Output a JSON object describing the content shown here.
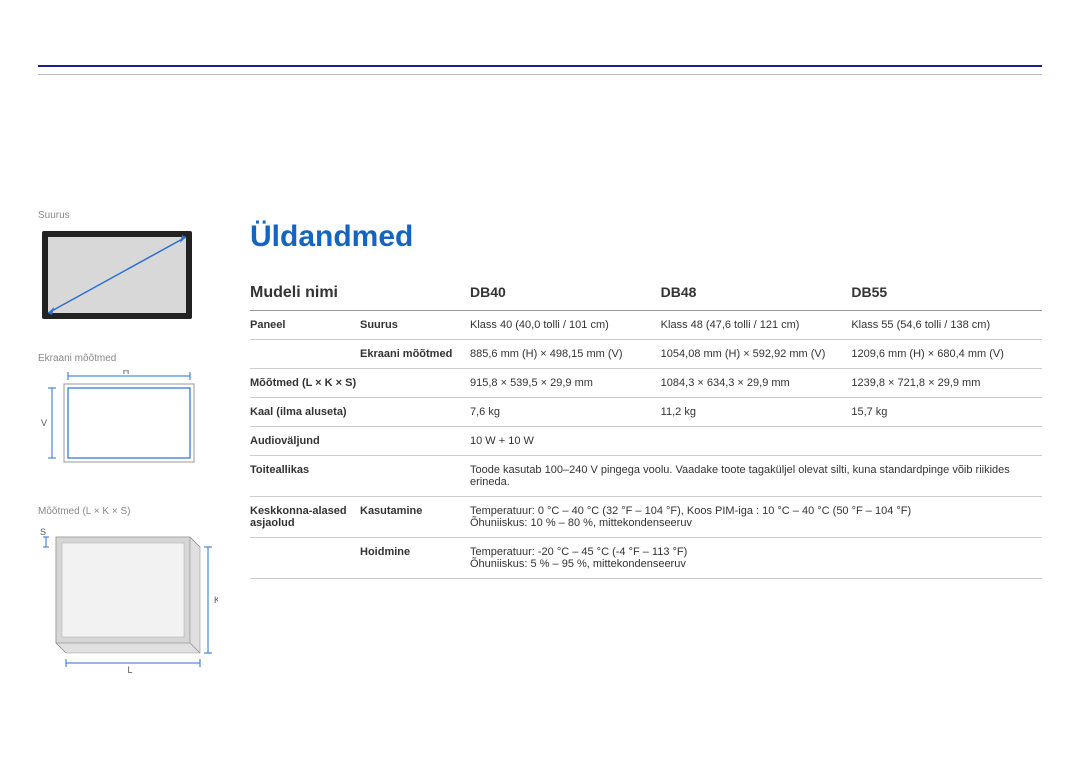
{
  "sidebar": {
    "size_label": "Suurus",
    "screen_dims_label": "Ekraani mõõtmed",
    "dims_label": "Mõõtmed (L × K × S)",
    "H": "H",
    "V": "V",
    "S": "S",
    "K": "K",
    "L": "L"
  },
  "page": {
    "title": "Üldandmed"
  },
  "header": {
    "model_name": "Mudeli nimi",
    "m1": "DB40",
    "m2": "DB48",
    "m3": "DB55"
  },
  "rows": {
    "panel": "Paneel",
    "size": "Suurus",
    "size_v1": "Klass 40 (40,0 tolli / 101 cm)",
    "size_v2": "Klass 48 (47,6 tolli / 121 cm)",
    "size_v3": "Klass 55 (54,6 tolli / 138 cm)",
    "screendims": "Ekraani mõõtmed",
    "sd_v1": "885,6 mm (H) × 498,15 mm (V)",
    "sd_v2": "1054,08 mm (H) × 592,92 mm (V)",
    "sd_v3": "1209,6 mm (H) × 680,4 mm (V)",
    "dims": "Mõõtmed (L × K × S)",
    "dims_v1": "915,8 × 539,5 × 29,9 mm",
    "dims_v2": "1084,3 × 634,3 × 29,9 mm",
    "dims_v3": "1239,8 × 721,8 × 29,9 mm",
    "weight": "Kaal (ilma aluseta)",
    "weight_v1": "7,6 kg",
    "weight_v2": "11,2 kg",
    "weight_v3": "15,7 kg",
    "audio": "Audioväljund",
    "audio_v": "10 W + 10 W",
    "power": "Toiteallikas",
    "power_v": "Toode kasutab 100–240 V pingega voolu. Vaadake toote tagaküljel olevat silti, kuna standardpinge võib riikides erineda.",
    "env": "Keskkonna-alased asjaolud",
    "use": "Kasutamine",
    "use_v": "Temperatuur: 0 °C – 40 °C (32 °F – 104 °F), Koos PIM-iga : 10 °C – 40 °C (50 °F – 104 °F)\nÕhuniiskus: 10 % – 80 %, mittekondenseeruv",
    "store": "Hoidmine",
    "store_v": "Temperatuur: -20 °C – 45 °C (-4 °F – 113 °F)\nÕhuniiskus: 5 % – 95 %, mittekondenseeruv"
  }
}
